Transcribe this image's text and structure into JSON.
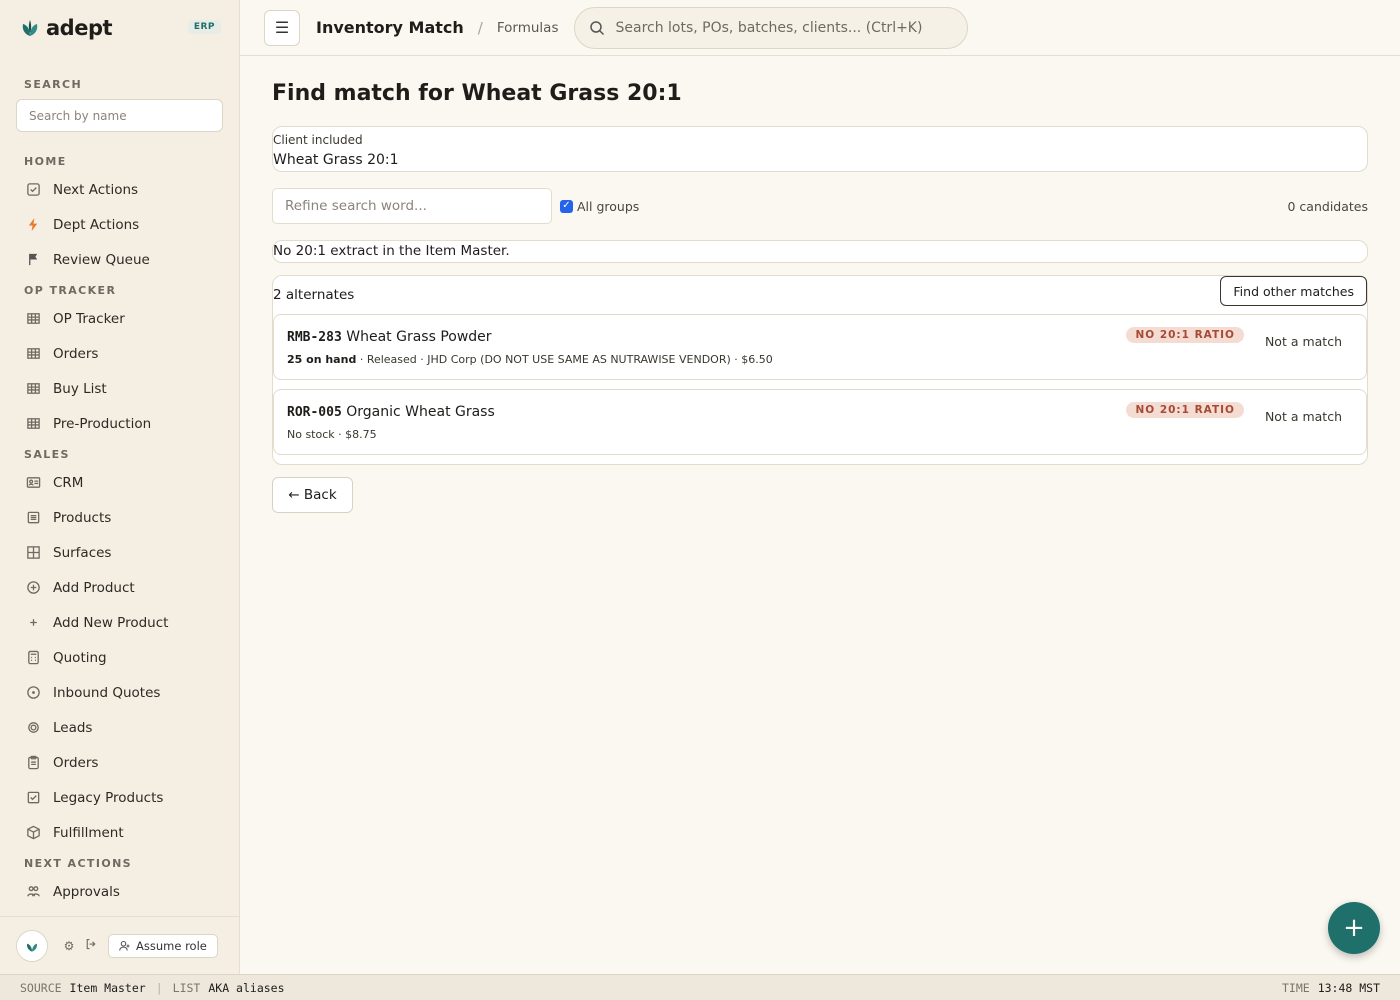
{
  "brand": {
    "name": "adept",
    "badge": "ERP"
  },
  "sidebar": {
    "search_label": "SEARCH",
    "search_placeholder": "Search by name",
    "sections": [
      {
        "label": "HOME",
        "items": [
          {
            "label": "Next Actions",
            "icon": "check-square-icon"
          },
          {
            "label": "Dept Actions",
            "icon": "lightning-icon"
          },
          {
            "label": "Review Queue",
            "icon": "flag-icon"
          }
        ]
      },
      {
        "label": "OP TRACKER",
        "items": [
          {
            "label": "OP Tracker",
            "icon": "grid-icon"
          },
          {
            "label": "Orders",
            "icon": "grid-icon"
          },
          {
            "label": "Buy List",
            "icon": "grid-icon"
          },
          {
            "label": "Pre-Production",
            "icon": "grid-icon"
          }
        ]
      },
      {
        "label": "SALES",
        "items": [
          {
            "label": "CRM",
            "icon": "contact-card-icon"
          },
          {
            "label": "Products",
            "icon": "list-icon"
          },
          {
            "label": "Surfaces",
            "icon": "layout-icon"
          },
          {
            "label": "Add Product",
            "icon": "plus-circle-icon"
          },
          {
            "label": "Add New Product",
            "icon": "plus-icon"
          },
          {
            "label": "Quoting",
            "icon": "calculator-icon"
          },
          {
            "label": "Inbound Quotes",
            "icon": "clock-icon"
          },
          {
            "label": "Leads",
            "icon": "target-icon"
          },
          {
            "label": "Orders",
            "icon": "clipboard-icon"
          },
          {
            "label": "Legacy Products",
            "icon": "checkbox-icon"
          },
          {
            "label": "Fulfillment",
            "icon": "box-icon"
          }
        ]
      },
      {
        "label": "NEXT ACTIONS",
        "items": [
          {
            "label": "Approvals",
            "icon": "users-icon"
          }
        ]
      }
    ],
    "footer": {
      "assume_role": "Assume role"
    }
  },
  "topbar": {
    "title": "Inventory Match",
    "breadcrumb": "Formulas",
    "search_placeholder": "Search lots, POs, batches, clients...  (Ctrl+K)"
  },
  "main": {
    "title": "Find match for Wheat Grass 20:1",
    "client_label": "Client included",
    "client_value": "Wheat Grass 20:1",
    "refine_placeholder": "Refine search word...",
    "all_groups_label": "All groups",
    "all_groups_checked": true,
    "candidates": "0 candidates",
    "notice": "No 20:1 extract in the Item Master.",
    "alternates_label": "2 alternates",
    "find_other_label": "Find other matches",
    "items": [
      {
        "code": "RMB-283",
        "name": "Wheat Grass Powder",
        "stock": "25 on hand",
        "details": " · Released · JHD Corp (DO NOT USE SAME AS NUTRAWISE VENDOR) · $6.50",
        "badge": "NO 20:1 RATIO",
        "action": "Not a match"
      },
      {
        "code": "ROR-005",
        "name": "Organic Wheat Grass",
        "stock": "",
        "details": "No stock · $8.75",
        "badge": "NO 20:1 RATIO",
        "action": "Not a match"
      }
    ],
    "back_label": "← Back"
  },
  "statusbar": {
    "source_key": "SOURCE",
    "source_val": "Item Master",
    "list_key": "LIST",
    "list_val": "AKA aliases",
    "time_key": "TIME",
    "time_val": "13:48 MST"
  },
  "colors": {
    "accent": "#1f6f6b",
    "badge_bg": "#f4dcd3",
    "badge_text": "#a44a35",
    "sidebar_bg": "#f5efe3",
    "page_bg": "#fbf8f1"
  }
}
